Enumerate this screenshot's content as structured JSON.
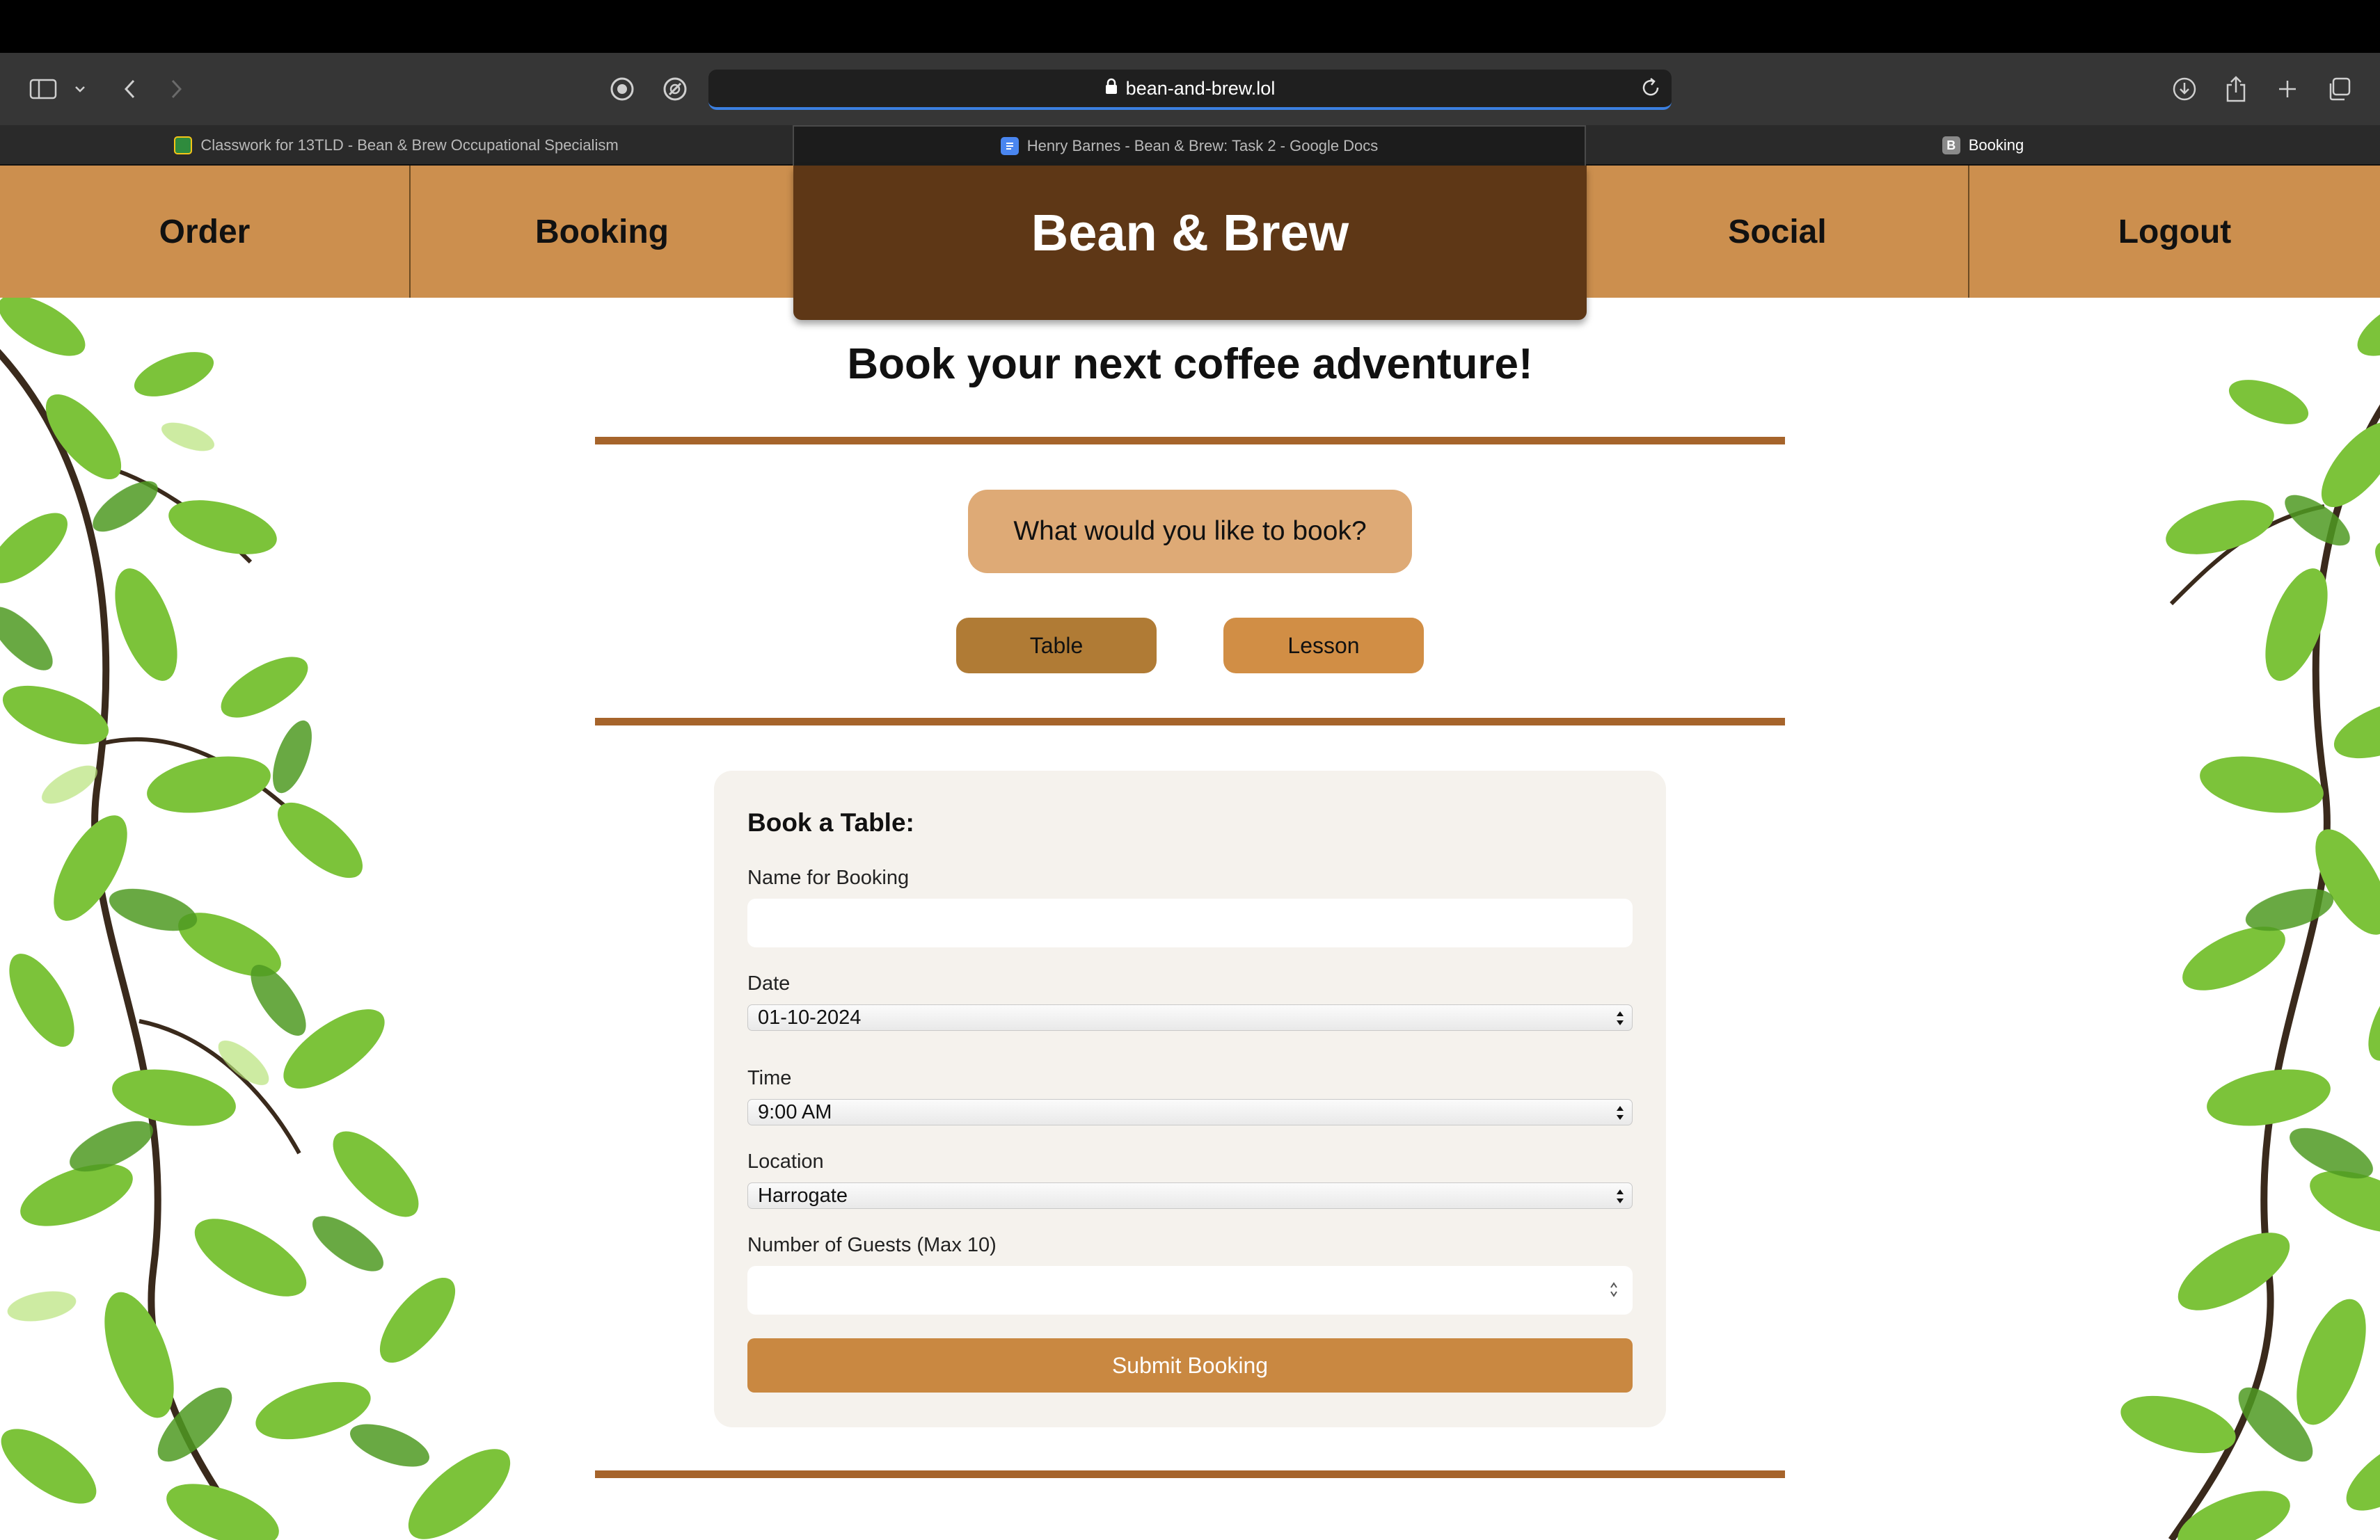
{
  "browser": {
    "url": "bean-and-brew.lol",
    "tabs": [
      {
        "label": "Classwork for 13TLD - Bean & Brew Occupational Specialism"
      },
      {
        "label": "Henry Barnes - Bean & Brew: Task 2 - Google Docs"
      },
      {
        "label": "Booking",
        "favicon_letter": "B"
      }
    ],
    "icons": [
      "sidebar-icon",
      "chevron-down-icon",
      "back-icon",
      "forward-icon",
      "record-icon",
      "no-tracking-icon",
      "lock-icon",
      "reload-icon",
      "download-icon",
      "share-icon",
      "plus-icon",
      "tabs-overview-icon"
    ]
  },
  "nav": {
    "order": "Order",
    "booking": "Booking",
    "brand": "Bean & Brew",
    "social": "Social",
    "logout": "Logout"
  },
  "main": {
    "headline": "Book your next coffee adventure!",
    "prompt": "What would you like to book?",
    "choices": {
      "table": "Table",
      "lesson": "Lesson"
    }
  },
  "form": {
    "title": "Book a Table:",
    "name_label": "Name for Booking",
    "name_value": "",
    "date_label": "Date",
    "date_value": "01-10-2024",
    "time_label": "Time",
    "time_value": "9:00 AM",
    "location_label": "Location",
    "location_value": "Harrogate",
    "guests_label": "Number of Guests (Max 10)",
    "guests_value": "",
    "submit_label": "Submit Booking"
  },
  "colors": {
    "nav_bg": "#cc8f4e",
    "brand_bg": "#5e3716",
    "rule": "#a6642b",
    "prompt_bg": "#deaa76",
    "table_button": "#b07b35",
    "lesson_button": "#d18e45",
    "submit_button": "#c98841",
    "card_bg": "#f5f2ed"
  }
}
